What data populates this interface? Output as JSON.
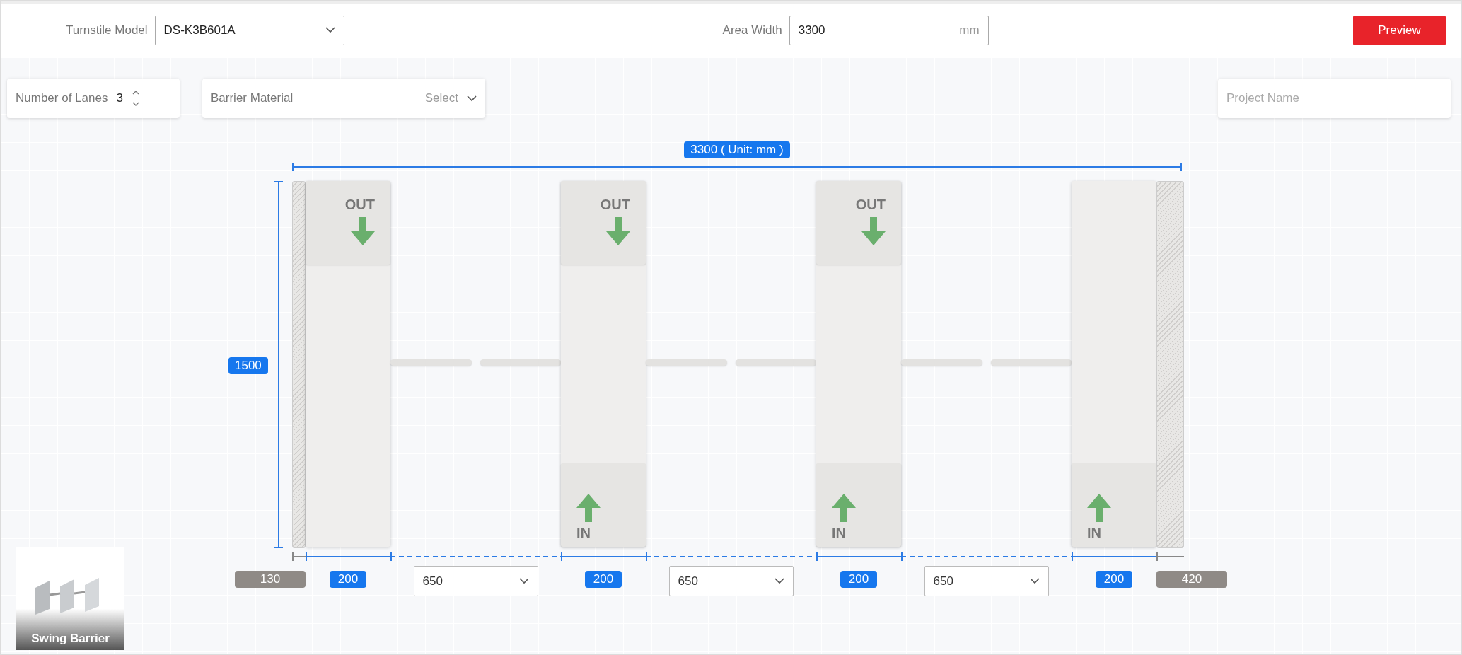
{
  "toolbar": {
    "turnstile_model": {
      "label": "Turnstile Model",
      "value": "DS-K3B601A"
    },
    "area_width": {
      "label": "Area Width",
      "value": "3300",
      "unit": "mm"
    },
    "preview_button": "Preview"
  },
  "options": {
    "lanes": {
      "label": "Number of Lanes",
      "value": "3"
    },
    "barrier_material": {
      "label": "Barrier Material",
      "placeholder": "Select"
    },
    "project_name": {
      "placeholder": "Project Name"
    }
  },
  "diagram": {
    "width_label": "3300 ( Unit: mm )",
    "height_label": "1500",
    "segments": [
      {
        "kind": "wall",
        "dimension": "130"
      },
      {
        "kind": "post",
        "dimension": "200",
        "panels": [
          {
            "kind": "out",
            "label": "OUT"
          }
        ]
      },
      {
        "kind": "lane",
        "dimension": "650"
      },
      {
        "kind": "post",
        "dimension": "200",
        "panels": [
          {
            "kind": "out",
            "label": "OUT"
          },
          {
            "kind": "in",
            "label": "IN"
          }
        ]
      },
      {
        "kind": "lane",
        "dimension": "650"
      },
      {
        "kind": "post",
        "dimension": "200",
        "panels": [
          {
            "kind": "out",
            "label": "OUT"
          },
          {
            "kind": "in",
            "label": "IN"
          }
        ]
      },
      {
        "kind": "lane",
        "dimension": "650"
      },
      {
        "kind": "post",
        "dimension": "200",
        "panels": [
          {
            "kind": "in",
            "label": "IN"
          }
        ]
      },
      {
        "kind": "wall",
        "dimension": "420"
      }
    ]
  },
  "thumbnail": {
    "caption": "Swing Barrier"
  }
}
